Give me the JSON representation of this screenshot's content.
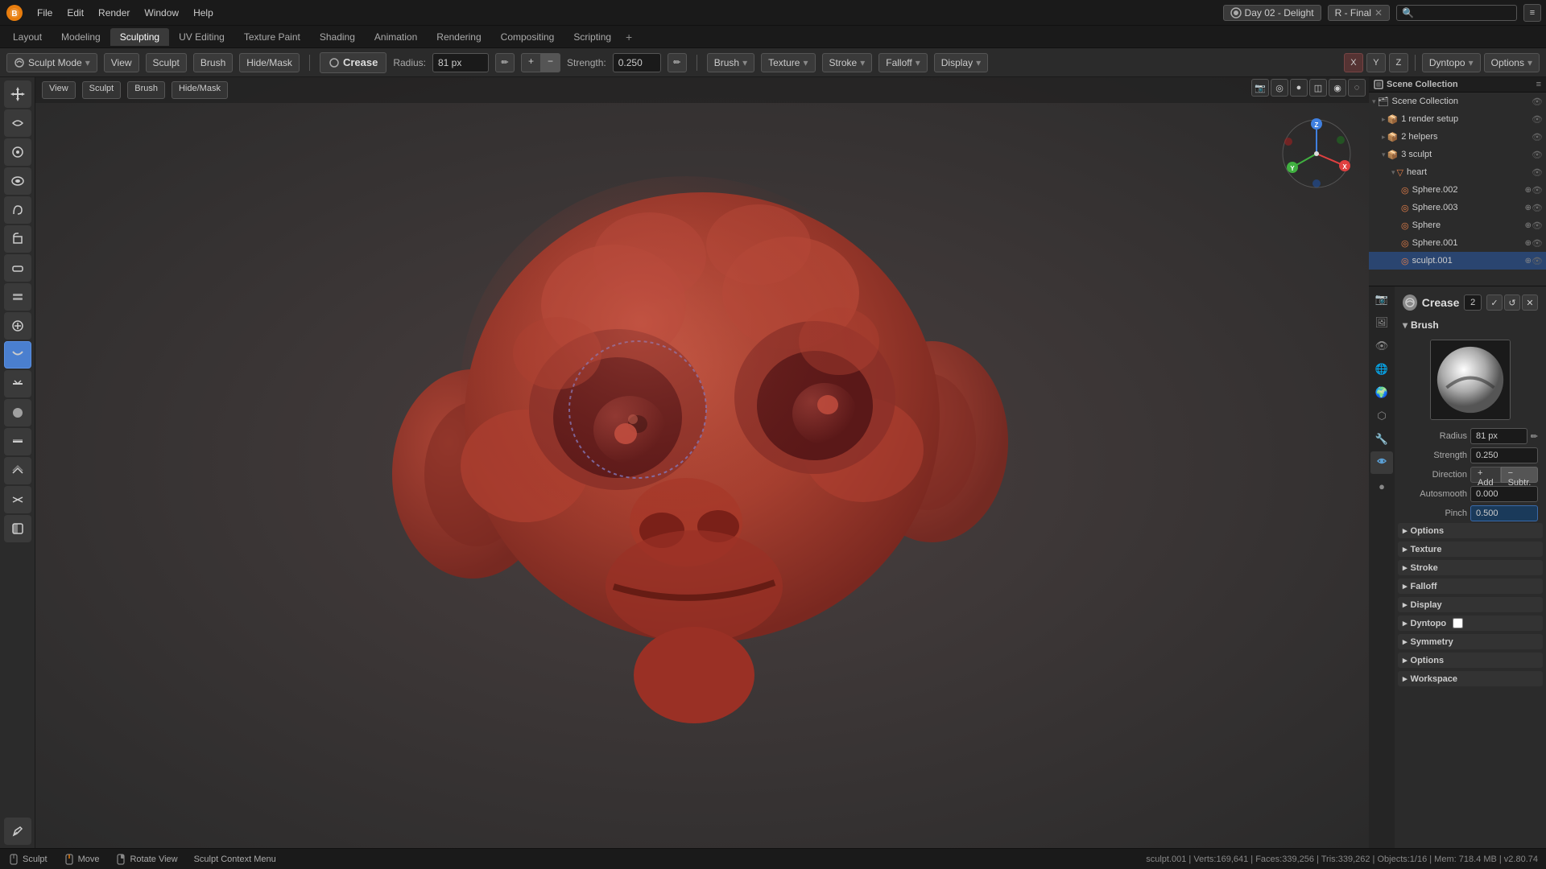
{
  "app": {
    "title": "Blender",
    "file_name": "Day 02 - Delight",
    "render_preset": "R - Final"
  },
  "top_menu": {
    "items": [
      "File",
      "Edit",
      "Render",
      "Window",
      "Help"
    ]
  },
  "workspace_tabs": {
    "tabs": [
      "Layout",
      "Modeling",
      "Sculpting",
      "UV Editing",
      "Texture Paint",
      "Shading",
      "Animation",
      "Rendering",
      "Compositing",
      "Scripting"
    ],
    "active": "Sculpting",
    "add_label": "+"
  },
  "toolbar": {
    "mode_label": "Sculpt Mode",
    "view_label": "View",
    "sculpt_label": "Sculpt",
    "brush_label": "Brush",
    "hide_mask_label": "Hide/Mask",
    "brush_name": "Crease",
    "radius_label": "Radius:",
    "radius_value": "81 px",
    "strength_label": "Strength:",
    "strength_value": "0.250",
    "add_label": "+",
    "subtract_label": "−",
    "brush_dropdown": "Brush",
    "texture_dropdown": "Texture",
    "stroke_dropdown": "Stroke",
    "falloff_dropdown": "Falloff",
    "display_dropdown": "Display",
    "dyntopo_label": "Dyntopo",
    "options_label": "Options"
  },
  "viewport": {
    "view_btn": "View",
    "sculpt_btn": "Sculpt",
    "brush_btn": "Brush",
    "hidemask_btn": "Hide/Mask",
    "gizmo_x": "X",
    "gizmo_y": "Y",
    "gizmo_z": "Z"
  },
  "status_bar": {
    "sculpt_label": "Sculpt",
    "move_label": "Move",
    "rotate_view_label": "Rotate View",
    "context_menu_label": "Sculpt Context Menu",
    "mesh_stats": "sculpt.001 | Verts:169,641 | Faces:339,256 | Tris:339,262 | Objects:1/16 | Mem: 718.4 MB | v2.80.74"
  },
  "outliner": {
    "header": "Scene Collection",
    "items": [
      {
        "indent": 0,
        "name": "Scene Collection",
        "icon": "📁",
        "expanded": true
      },
      {
        "indent": 1,
        "name": "1 render setup",
        "icon": "📦",
        "expanded": false
      },
      {
        "indent": 1,
        "name": "2 helpers",
        "icon": "📦",
        "expanded": false
      },
      {
        "indent": 1,
        "name": "3 sculpt",
        "icon": "📦",
        "expanded": true
      },
      {
        "indent": 2,
        "name": "heart",
        "icon": "❤",
        "expanded": false
      },
      {
        "indent": 3,
        "name": "Sphere.002",
        "icon": "◎",
        "expanded": false
      },
      {
        "indent": 3,
        "name": "Sphere.003",
        "icon": "◎",
        "expanded": false
      },
      {
        "indent": 3,
        "name": "Sphere",
        "icon": "◎",
        "expanded": false
      },
      {
        "indent": 3,
        "name": "Sphere.001",
        "icon": "◎",
        "expanded": false
      },
      {
        "indent": 3,
        "name": "sculpt.001",
        "icon": "◎",
        "expanded": false,
        "selected": true
      }
    ]
  },
  "properties": {
    "brush_title": "Crease",
    "brush_num": "2",
    "brush_section": "Brush",
    "radius_label": "Radius",
    "radius_value": "81 px",
    "strength_label": "Strength",
    "strength_value": "0.250",
    "direction_label": "Direction",
    "direction_add": "Add",
    "direction_sub": "Subtr.",
    "autosmooth_label": "Autosmooth",
    "autosmooth_value": "0.000",
    "pinch_label": "Pinch",
    "pinch_value": "0.500",
    "sections": [
      {
        "id": "options",
        "label": "Options",
        "collapsed": true
      },
      {
        "id": "texture",
        "label": "Texture",
        "collapsed": true
      },
      {
        "id": "stroke",
        "label": "Stroke",
        "collapsed": true
      },
      {
        "id": "falloff",
        "label": "Falloff",
        "collapsed": true
      },
      {
        "id": "display",
        "label": "Display",
        "collapsed": true
      },
      {
        "id": "dyntopo",
        "label": "Dyntopo",
        "collapsed": true
      },
      {
        "id": "symmetry",
        "label": "Symmetry",
        "collapsed": true
      },
      {
        "id": "options2",
        "label": "Options",
        "collapsed": true
      },
      {
        "id": "workspace",
        "label": "Workspace",
        "collapsed": true
      }
    ]
  },
  "tools": {
    "buttons": [
      {
        "id": "transform",
        "label": "↕",
        "active": false
      },
      {
        "id": "smooth",
        "label": "~",
        "active": false
      },
      {
        "id": "grab",
        "label": "✋",
        "active": false
      },
      {
        "id": "elastic",
        "label": "⊕",
        "active": false
      },
      {
        "id": "snake",
        "label": "S",
        "active": false
      },
      {
        "id": "thumb",
        "label": "T",
        "active": false
      },
      {
        "id": "clay",
        "label": "C",
        "active": false
      },
      {
        "id": "clay_strips",
        "label": "║",
        "active": false
      },
      {
        "id": "inflate",
        "label": "◉",
        "active": false
      },
      {
        "id": "crease",
        "label": "▼",
        "active": true
      },
      {
        "id": "flatten",
        "label": "▬",
        "active": false
      },
      {
        "id": "fill",
        "label": "●",
        "active": false
      },
      {
        "id": "scrape",
        "label": "⊓",
        "active": false
      },
      {
        "id": "multiplane",
        "label": "⊞",
        "active": false
      },
      {
        "id": "pinch",
        "label": "↔",
        "active": false
      },
      {
        "id": "mask",
        "label": "◧",
        "active": false
      },
      {
        "id": "annotate",
        "label": "✏",
        "active": false
      }
    ]
  }
}
